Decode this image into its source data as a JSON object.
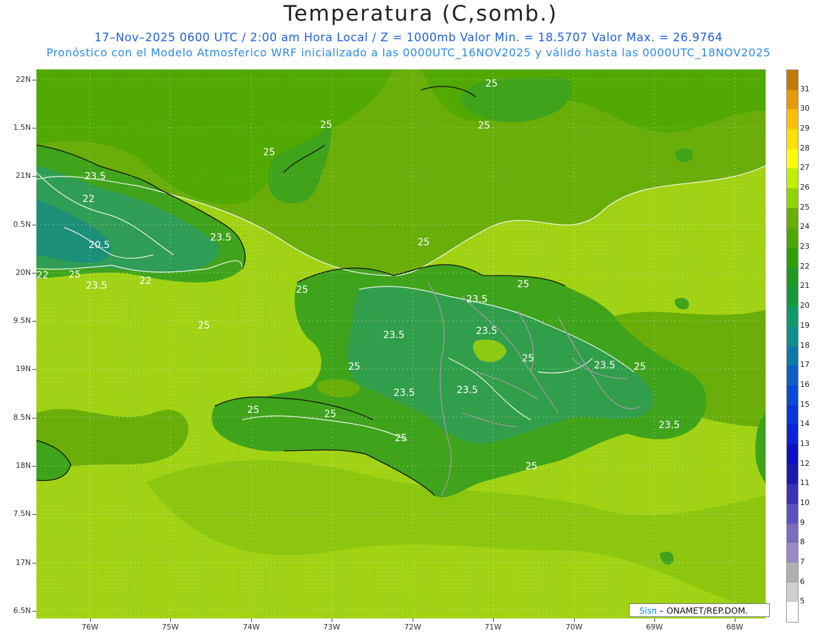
{
  "title": "Temperatura (C,somb.)",
  "subtitle_line1": "17–Nov–2025  0600 UTC / 2:00 am Hora Local / Z = 1000mb    Valor Min. = 18.5707  Valor Max. = 26.9764",
  "subtitle_line2": "Pronóstico con el Modelo Atmosferico WRF inicializado a las 0000UTC_16NOV2025 y válido hasta las  0000UTC_18NOV2025",
  "credit": {
    "brand": "Sisπ",
    "text": " – ONAMET/REP.DOM."
  },
  "lat_labels": [
    "22N",
    "1.5N",
    "21N",
    "0.5N",
    "20N",
    "9.5N",
    "19N",
    "8.5N",
    "18N",
    "7.5N",
    "17N",
    "6.5N"
  ],
  "lon_labels": [
    "76W",
    "75W",
    "74W",
    "73W",
    "72W",
    "71W",
    "70W",
    "69W",
    "68W"
  ],
  "colorbar": {
    "labels": [
      "31",
      "30",
      "29",
      "28",
      "27",
      "26",
      "25",
      "24",
      "23",
      "22",
      "21",
      "20",
      "19",
      "18",
      "17",
      "16",
      "15",
      "14",
      "13",
      "12",
      "11",
      "10",
      "9",
      "8",
      "7",
      "6",
      "5"
    ],
    "colors": [
      "#c07a00",
      "#e69a00",
      "#ffbf00",
      "#ffe000",
      "#ffff00",
      "#bff000",
      "#8fd400",
      "#6aae00",
      "#4fa800",
      "#2fa000",
      "#1f9a20",
      "#139a3c",
      "#0f9a6c",
      "#0e8f8c",
      "#0c79a8",
      "#0b61c4",
      "#0a4ad6",
      "#0a36e0",
      "#0a22d8",
      "#0b10c0",
      "#1c18b0",
      "#3b32b8",
      "#5b52c0",
      "#7d6cc0",
      "#9a8ac4",
      "#b0b0b0",
      "#cfcfcf",
      "#ffffff"
    ]
  },
  "contour_labels": [
    "25",
    "25",
    "25",
    "25",
    "23.5",
    "22",
    "20.5",
    "23.5",
    "22",
    "25",
    "22",
    "23.5",
    "25",
    "25",
    "23.5",
    "23.5",
    "25",
    "23.5",
    "23.5",
    "25",
    "23.5",
    "25",
    "25",
    "25",
    "23.5",
    "25",
    "25",
    "25",
    "23.5",
    "25"
  ],
  "map_colors": {
    "sea": "#a2d415",
    "land_mid": "#68ad0c",
    "land_high": "#3fa31b",
    "cool": "#2f9d55",
    "cold": "#1c8f78"
  }
}
